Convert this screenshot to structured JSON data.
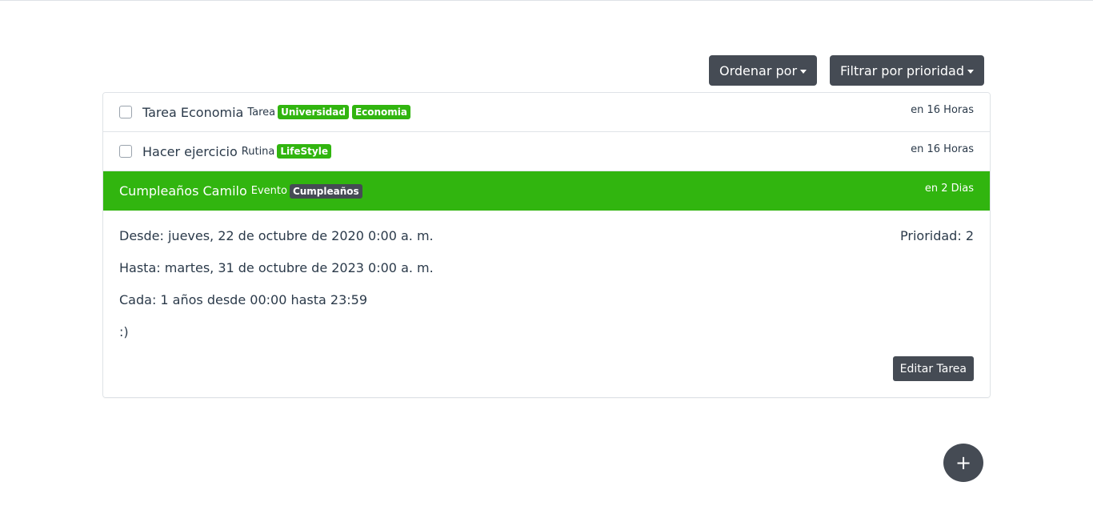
{
  "toolbar": {
    "sort_label": "Ordenar por",
    "filter_label": "Filtrar por prioridad"
  },
  "tasks": [
    {
      "title": "Tarea Economia",
      "type": "Tarea",
      "tags": [
        "Universidad",
        "Economia"
      ],
      "when": "en 16 Horas"
    },
    {
      "title": "Hacer ejercicio",
      "type": "Rutina",
      "tags": [
        "LifeStyle"
      ],
      "when": "en 16 Horas"
    },
    {
      "title": "Cumpleaños Camilo",
      "type": "Evento",
      "tags": [
        "Cumpleaños"
      ],
      "when": "en 2 Dias"
    }
  ],
  "details": {
    "desde": "Desde: jueves, 22 de octubre de 2020 0:00 a. m.",
    "hasta": "Hasta: martes, 31 de octubre de 2023 0:00 a. m.",
    "cada": "Cada: 1 años desde 00:00 hasta 23:59",
    "nota": ":)",
    "prioridad": "Prioridad: 2",
    "edit_label": "Editar Tarea"
  },
  "fab": {
    "label": "+"
  },
  "colors": {
    "accent_green": "#31b50f",
    "dark": "#454b54",
    "text": "#2b3a4a",
    "border": "#dfe3e7"
  }
}
